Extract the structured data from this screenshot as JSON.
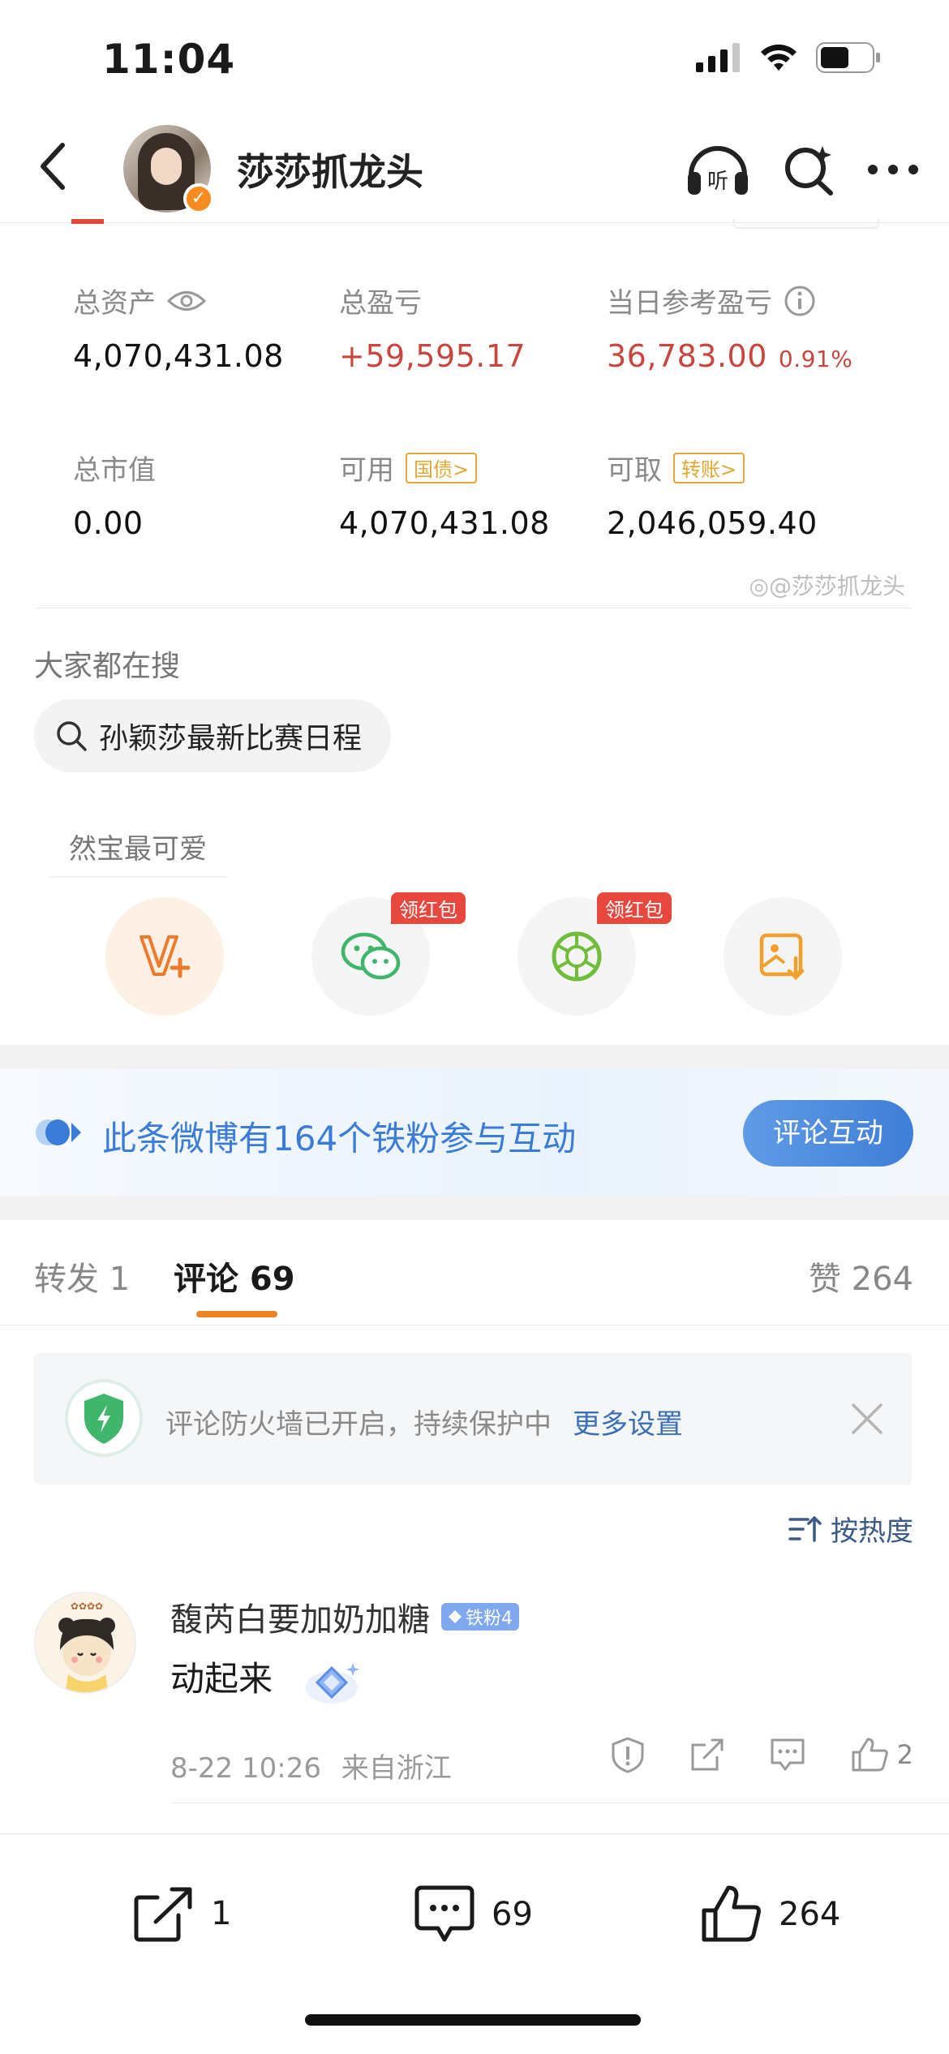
{
  "status_bar": {
    "time": "11:04"
  },
  "header": {
    "username": "莎莎抓龙头"
  },
  "account": {
    "total_assets_label": "总资产",
    "total_assets_value": "4,070,431.08",
    "total_pnl_label": "总盈亏",
    "total_pnl_value": "+59,595.17",
    "daily_pnl_label": "当日参考盈亏",
    "daily_pnl_value": "36,783.00",
    "daily_pnl_pct": "0.91%",
    "market_value_label": "总市值",
    "market_value_value": "0.00",
    "available_label": "可用",
    "available_tag": "国债>",
    "available_value": "4,070,431.08",
    "withdrawable_label": "可取",
    "withdrawable_tag": "转账>",
    "withdrawable_value": "2,046,059.40",
    "watermark": "@莎莎抓龙头"
  },
  "search": {
    "title": "大家都在搜",
    "query": "孙颖莎最新比赛日程"
  },
  "share": {
    "bubble": "然宝最可爱",
    "redpack_label": "领红包"
  },
  "fans_banner": {
    "text": "此条微博有164个铁粉参与互动",
    "button": "评论互动"
  },
  "tabs": {
    "repost": "转发 1",
    "comments": "评论 69",
    "likes": "赞 264"
  },
  "notice": {
    "text": "评论防火墙已开启，持续保护中",
    "link": "更多设置"
  },
  "sort": {
    "label": "按热度"
  },
  "comment": {
    "username": "馥芮白要加奶加糖",
    "badge": "铁粉4",
    "text": "动起来",
    "time": "8-22 10:26",
    "location": "来自浙江",
    "likes": "2"
  },
  "bottom_bar": {
    "repost_count": "1",
    "comment_count": "69",
    "like_count": "264"
  }
}
